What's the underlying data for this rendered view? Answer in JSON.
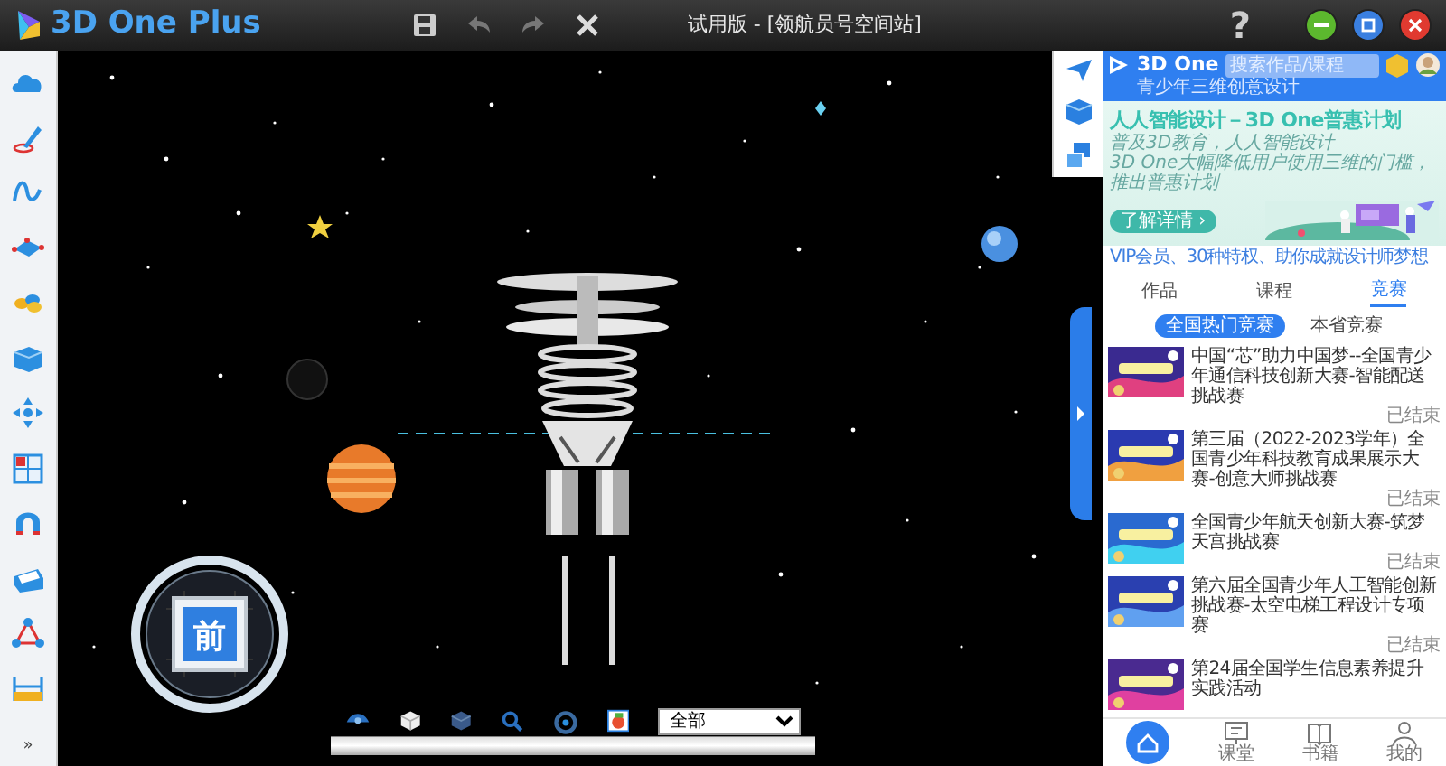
{
  "app": {
    "name": "3D One Plus"
  },
  "window": {
    "title": "试用版 - [领航员号空间站]"
  },
  "help": {
    "label": "?"
  },
  "left_toolbar": {
    "more": "»"
  },
  "view_cube": {
    "face": "前"
  },
  "view_toolbar": {
    "filter": "全部"
  },
  "panel": {
    "logo": {
      "name": "3D One",
      "tagline": "青少年三维创意设计"
    },
    "search": {
      "placeholder": "搜索作品/课程"
    },
    "banner": {
      "title": "人人智能设计－3D One普惠计划",
      "lines": [
        "普及3D教育，人人智能设计",
        "3D One大幅降低用户使用三维的门槛，推出普惠计划"
      ],
      "button": "了解详情 ›"
    },
    "vip": "VIP会员、30种特权、助你成就设计师梦想",
    "tabs": [
      {
        "label": "作品",
        "selected": false
      },
      {
        "label": "课程",
        "selected": false
      },
      {
        "label": "竞赛",
        "selected": true
      }
    ],
    "filters": [
      {
        "label": "全国热门竞赛",
        "selected": true
      },
      {
        "label": "本省竞赛",
        "selected": false
      }
    ],
    "contests": [
      {
        "title": "中国“芯”助力中国梦--全国青少年通信科技创新大赛-智能配送挑战赛",
        "status": "已结束"
      },
      {
        "title": "第三届（2022-2023学年）全国青少年科技教育成果展示大赛-创意大师挑战赛",
        "status": "已结束"
      },
      {
        "title": "全国青少年航天创新大赛-筑梦天宫挑战赛",
        "status": "已结束"
      },
      {
        "title": "第六届全国青少年人工智能创新挑战赛-太空电梯工程设计专项赛",
        "status": "已结束"
      },
      {
        "title": "第24届全国学生信息素养提升实践活动"
      }
    ],
    "bottom_nav": [
      {
        "kind": "home",
        "selected": true
      },
      {
        "kind": "class",
        "label": "课堂",
        "selected": false
      },
      {
        "kind": "book",
        "label": "书籍",
        "selected": false
      },
      {
        "kind": "user",
        "label": "我的",
        "selected": false
      }
    ]
  }
}
